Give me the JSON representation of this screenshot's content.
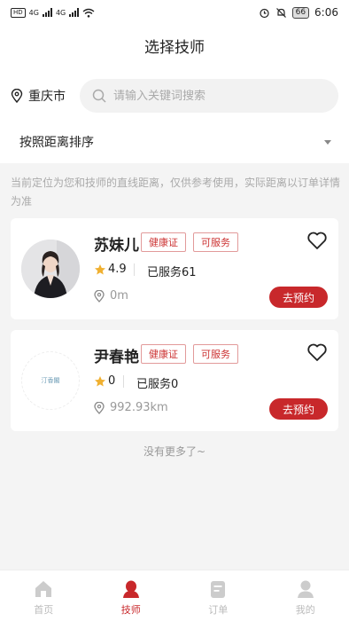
{
  "status_bar": {
    "left_tag": "HD",
    "net1": "4G",
    "net2": "4G",
    "battery": "66",
    "time": "6:06"
  },
  "header": {
    "title": "选择技师"
  },
  "filter": {
    "city": "重庆市",
    "search_placeholder": "请输入关键词搜索",
    "sort_label": "按照距离排序"
  },
  "notice": "当前定位为您和技师的直线距离，仅供参考使用，实际距离以订单详情为准",
  "technicians": [
    {
      "name": "苏妹儿",
      "tags": [
        "健康证",
        "可服务"
      ],
      "rating": "4.9",
      "served": "已服务61",
      "distance": "0m",
      "book_label": "去预约"
    },
    {
      "name": "尹春艳",
      "tags": [
        "健康证",
        "可服务"
      ],
      "rating": "0",
      "served": "已服务0",
      "distance": "992.93km",
      "book_label": "去预约",
      "avatar_text": "汀香閣"
    }
  ],
  "no_more": "没有更多了~",
  "tabs": [
    {
      "label": "首页",
      "icon": "home-icon",
      "active": false
    },
    {
      "label": "技师",
      "icon": "technician-icon",
      "active": true
    },
    {
      "label": "订单",
      "icon": "order-icon",
      "active": false
    },
    {
      "label": "我的",
      "icon": "profile-icon",
      "active": false
    }
  ],
  "colors": {
    "accent": "#c8282b",
    "star": "#f0b030",
    "tag_border": "#e29a9a"
  }
}
